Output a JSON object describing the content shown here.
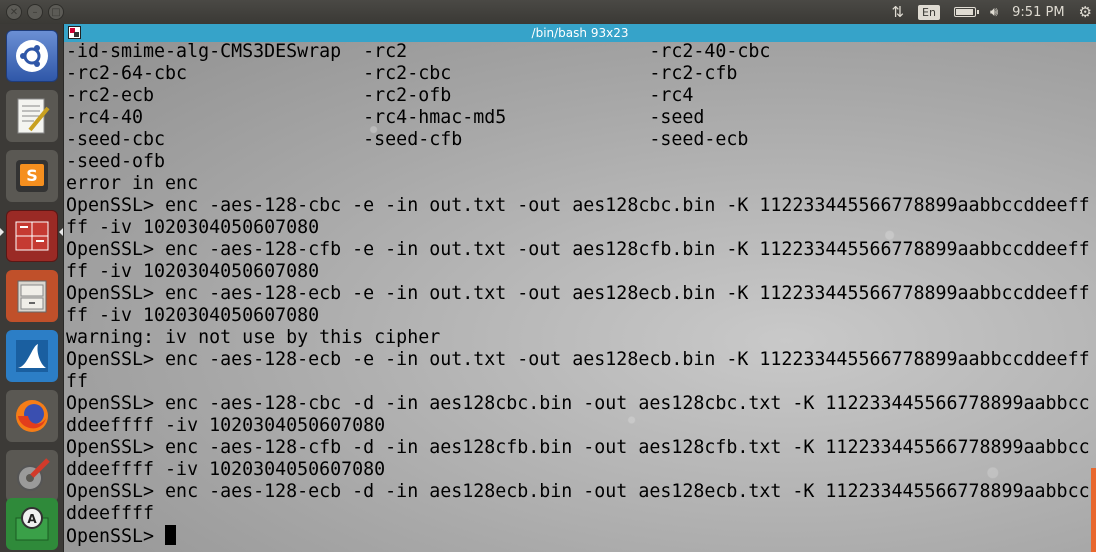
{
  "panel": {
    "language": "En",
    "time": "9:51 PM",
    "icons": [
      "network-icon",
      "keyboard-layout-icon",
      "battery-icon",
      "volume-icon",
      "time",
      "settings-gear-icon"
    ]
  },
  "launcher": {
    "items": [
      {
        "name": "ubuntu-dash-icon"
      },
      {
        "name": "text-editor-icon"
      },
      {
        "name": "sublime-text-icon"
      },
      {
        "name": "terminal-icon"
      },
      {
        "name": "file-cabinet-icon"
      },
      {
        "name": "wireshark-icon"
      },
      {
        "name": "firefox-icon"
      },
      {
        "name": "system-settings-icon"
      },
      {
        "name": "software-updater-icon"
      }
    ]
  },
  "terminal": {
    "title": "/bin/bash 93x23",
    "lines": [
      "-id-smime-alg-CMS3DESwrap  -rc2                      -rc2-40-cbc",
      "-rc2-64-cbc                -rc2-cbc                  -rc2-cfb",
      "-rc2-ecb                   -rc2-ofb                  -rc4",
      "-rc4-40                    -rc4-hmac-md5             -seed",
      "-seed-cbc                  -seed-cfb                 -seed-ecb",
      "-seed-ofb",
      "error in enc",
      "OpenSSL> enc -aes-128-cbc -e -in out.txt -out aes128cbc.bin -K 112233445566778899aabbccddeeff",
      "ff -iv 1020304050607080",
      "OpenSSL> enc -aes-128-cfb -e -in out.txt -out aes128cfb.bin -K 112233445566778899aabbccddeeff",
      "ff -iv 1020304050607080",
      "OpenSSL> enc -aes-128-ecb -e -in out.txt -out aes128ecb.bin -K 112233445566778899aabbccddeeff",
      "ff -iv 1020304050607080",
      "warning: iv not use by this cipher",
      "OpenSSL> enc -aes-128-ecb -e -in out.txt -out aes128ecb.bin -K 112233445566778899aabbccddeeff",
      "ff",
      "OpenSSL> enc -aes-128-cbc -d -in aes128cbc.bin -out aes128cbc.txt -K 112233445566778899aabbcc",
      "ddeeffff -iv 1020304050607080",
      "OpenSSL> enc -aes-128-cfb -d -in aes128cfb.bin -out aes128cfb.txt -K 112233445566778899aabbcc",
      "ddeeffff -iv 1020304050607080",
      "OpenSSL> enc -aes-128-ecb -d -in aes128ecb.bin -out aes128ecb.txt -K 112233445566778899aabbcc",
      "ddeeffff"
    ],
    "prompt": "OpenSSL> "
  }
}
